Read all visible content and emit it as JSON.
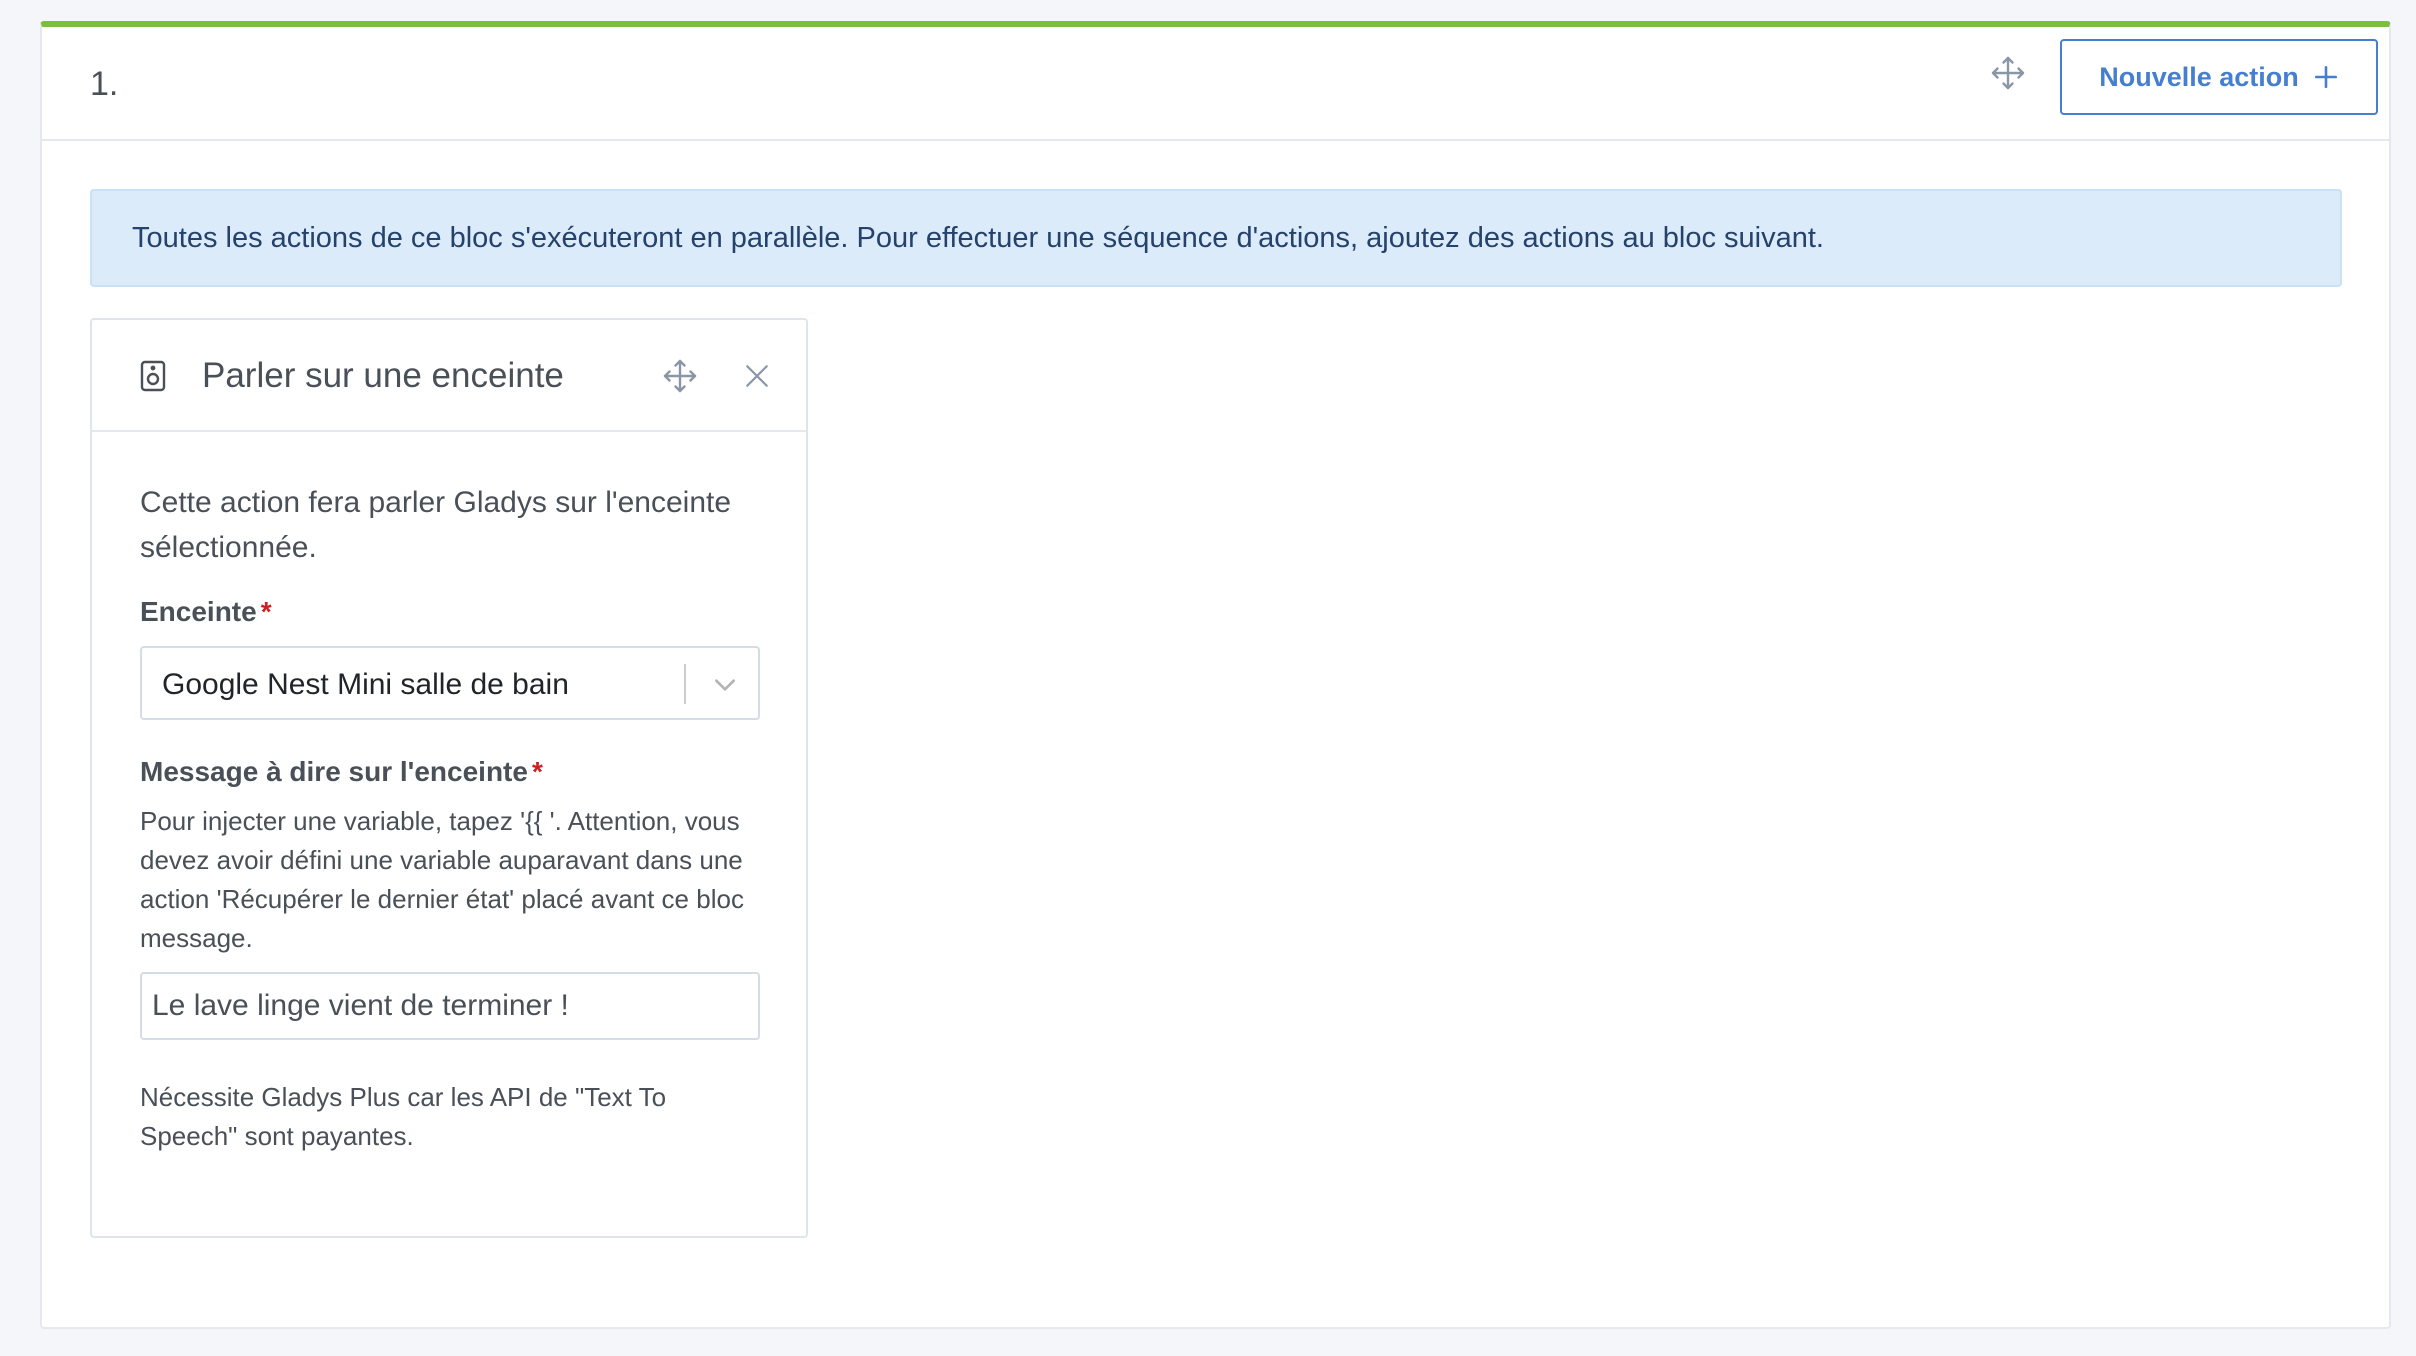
{
  "block": {
    "number": "1.",
    "new_action_label": "Nouvelle action",
    "info_message": "Toutes les actions de ce bloc s'exécuteront en parallèle. Pour effectuer une séquence d'actions, ajoutez des actions au bloc suivant."
  },
  "action": {
    "icon": "speaker-icon",
    "title": "Parler sur une enceinte",
    "description": "Cette action fera parler Gladys sur l'enceinte sélectionnée.",
    "speaker_label": "Enceinte",
    "required_marker": "*",
    "speaker_selected": "Google Nest Mini salle de bain",
    "message_label": "Message à dire sur l'enceinte",
    "message_help": "Pour injecter une variable, tapez '{{ '. Attention, vous devez avoir défini une variable auparavant dans une action 'Récupérer le dernier état' placé avant ce bloc message.",
    "message_value": "Le lave linge vient de terminer !",
    "footnote": "Nécessite Gladys Plus car les API de \"Text To Speech\" sont payantes."
  },
  "colors": {
    "accent": "#467fcf",
    "block_top_border": "#7bbf3d",
    "info_background": "#dbebf9",
    "info_text": "#24426c",
    "required": "#cd201f"
  }
}
